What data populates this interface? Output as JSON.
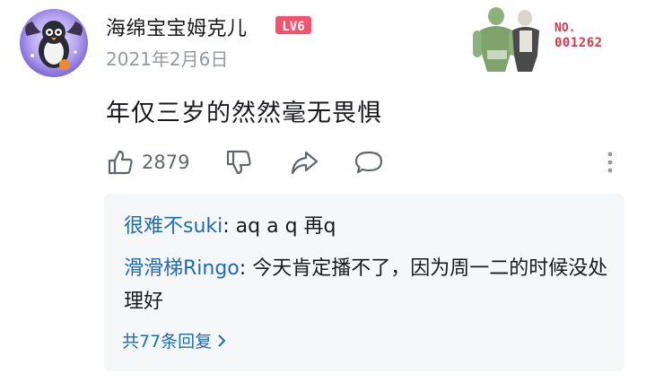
{
  "comment": {
    "username": "海绵宝宝姆克儿",
    "level_badge": "LV6",
    "date": "2021年2月6日",
    "text": "年仅三岁的然然毫无畏惧",
    "like_count": "2879",
    "fan_card": {
      "label": "NO.",
      "number": "001262"
    }
  },
  "replies": {
    "items": [
      {
        "author": "很难不suki",
        "separator": ": ",
        "text": "aq a q 再q"
      },
      {
        "author": "滑滑梯Ringo",
        "separator": ": ",
        "text": "今天肯定播不了，因为周一二的时候没处理好"
      }
    ],
    "view_more": "共77条回复"
  },
  "colors": {
    "accent_link": "#1e6bb8",
    "level_badge": "#f2546e",
    "fan_number": "#e0364a",
    "secondary_text": "#9499a0",
    "reply_background": "#f6f7f8"
  },
  "icons": [
    "avatar",
    "thumbs-up-icon",
    "thumbs-down-icon",
    "share-icon",
    "comment-icon",
    "more-vertical-icon",
    "chevron-right-icon"
  ]
}
